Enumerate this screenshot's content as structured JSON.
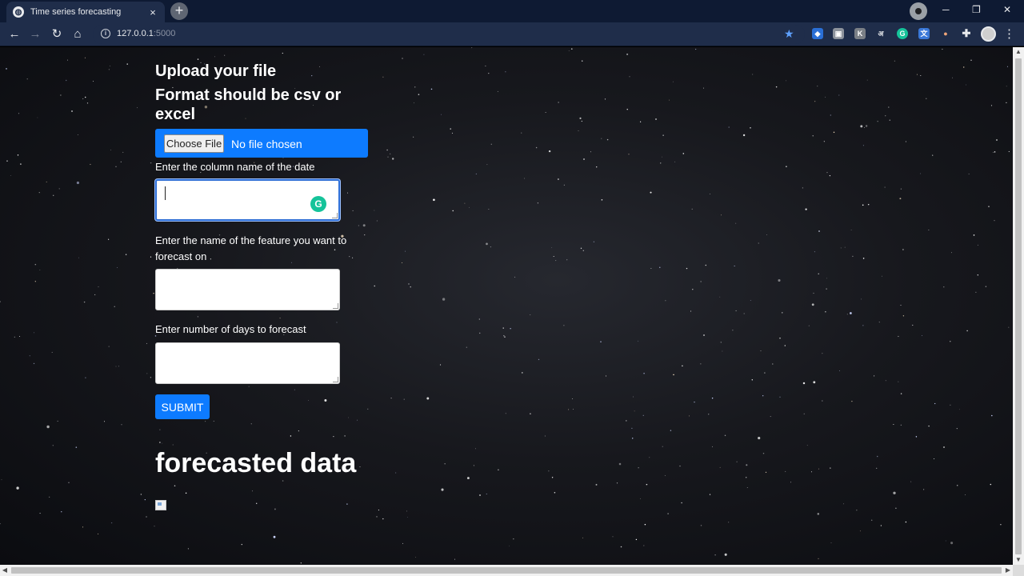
{
  "browser": {
    "tab_title": "Time series forecasting",
    "tab_close": "×",
    "new_tab": "+",
    "url_host": "127.0.0.1",
    "url_port": ":5000",
    "window": {
      "minimize": "─",
      "maximize": "❐",
      "close": "✕"
    },
    "nav": {
      "back": "←",
      "forward": "→",
      "reload": "↻",
      "home": "⌂"
    },
    "extensions": [
      "G",
      "K",
      "अ"
    ]
  },
  "page": {
    "heading_upload": "Upload your file",
    "heading_format": "Format should be csv or excel",
    "file_input": {
      "button_label": "Choose File",
      "status": "No file chosen"
    },
    "date_label": "Enter the column name of the date",
    "feature_label": "Enter the name of the feature you want to forecast on",
    "days_label": "Enter number of days to forecast",
    "date_value": "",
    "feature_value": "",
    "days_value": "",
    "submit_label": "SUBMIT",
    "forecast_heading": "forecasted data"
  },
  "colors": {
    "primary_button": "#0d7bff",
    "chrome_frame": "#0e1a33",
    "chrome_toolbar": "#1f2d4a"
  }
}
